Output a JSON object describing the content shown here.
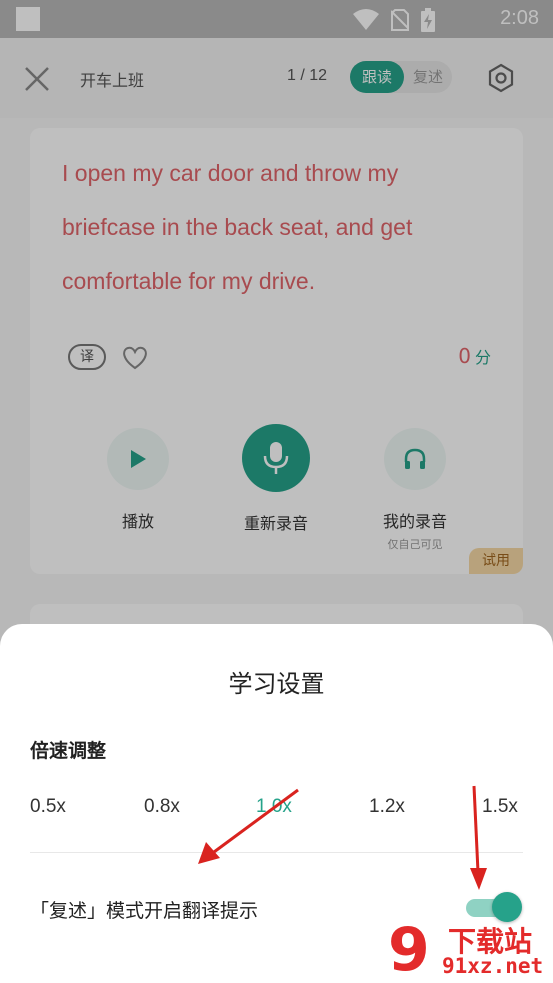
{
  "statusbar": {
    "time": "2:08",
    "icons": [
      "wifi-icon",
      "no-sim-icon",
      "battery-charging-icon"
    ]
  },
  "header": {
    "title": "开车上班",
    "counter": "1 / 12",
    "modes": [
      "跟读",
      "复述"
    ],
    "active_mode": "跟读"
  },
  "card": {
    "sentence": "I open my car door and throw my briefcase in the back seat, and get comfortable for my drive.",
    "translate_label": "译",
    "score_value": "0",
    "score_unit": "分",
    "controls": {
      "play_label": "播放",
      "rerecord_label": "重新录音",
      "my_recording_label": "我的录音",
      "my_recording_sub": "仅自己可见"
    },
    "trial_badge": "试用"
  },
  "sheet": {
    "title": "学习设置",
    "speed_label": "倍速调整",
    "speeds": [
      "0.5x",
      "0.8x",
      "1.0x",
      "1.2x",
      "1.5x"
    ],
    "selected_speed": "1.0x",
    "translation_hint_label": "「复述」模式开启翻译提示",
    "translation_hint_enabled": true
  },
  "watermark": {
    "logo_text": "9",
    "top_text": "下载站",
    "bottom_text": "91xz.net"
  },
  "colors": {
    "accent": "#26a28a",
    "sentence": "#e0646a",
    "annotation_arrow": "#d9231f",
    "watermark": "#e32b2b"
  }
}
